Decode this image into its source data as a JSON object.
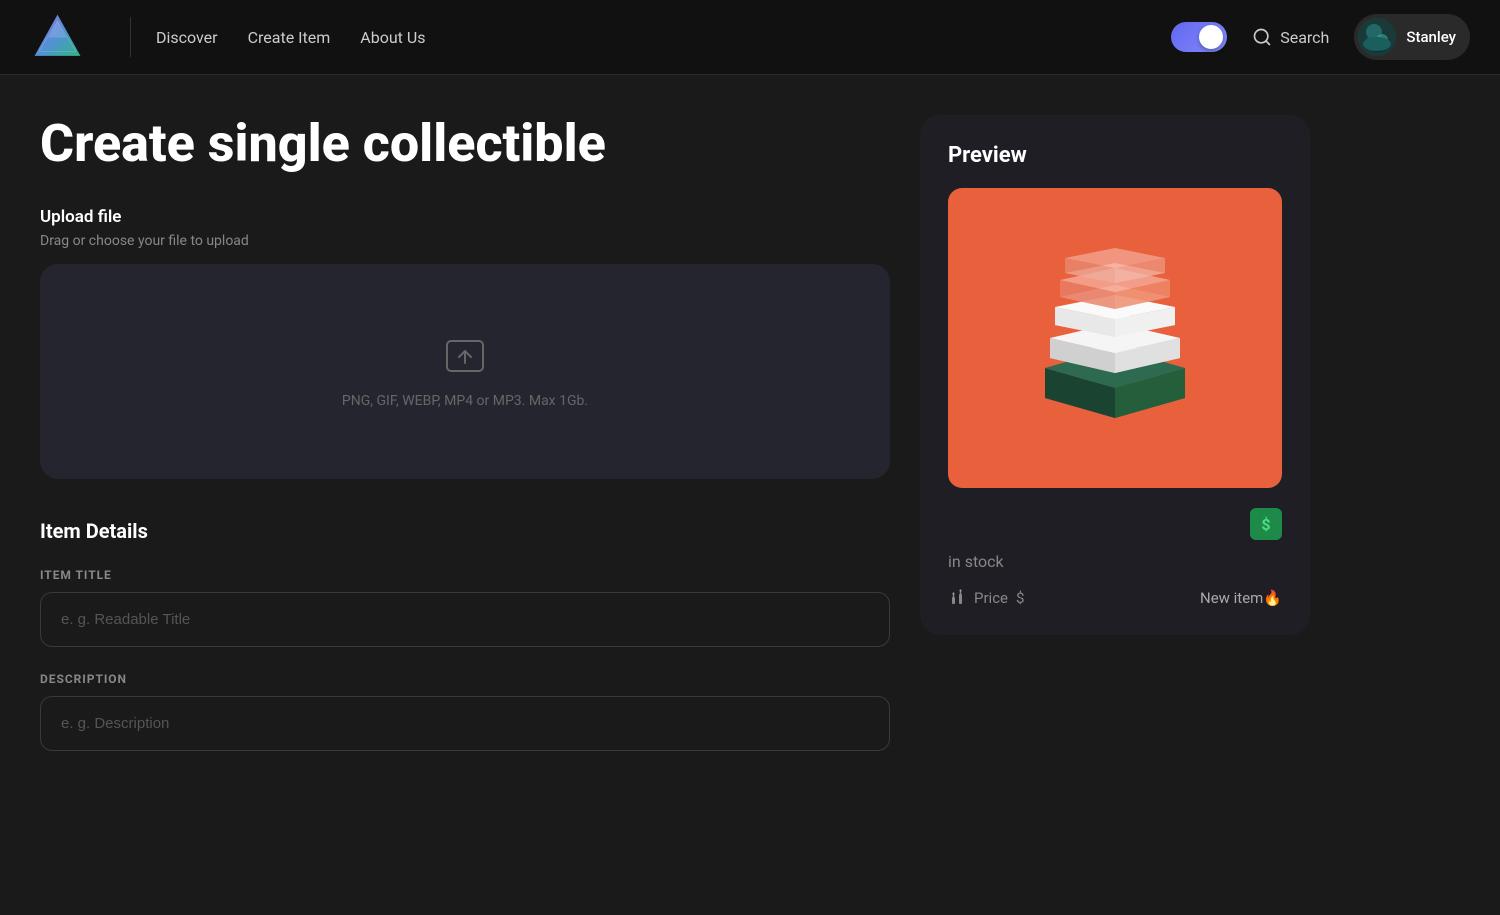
{
  "navbar": {
    "logo_alt": "Logo",
    "nav_links": [
      {
        "label": "Discover",
        "id": "discover"
      },
      {
        "label": "Create Item",
        "id": "create-item"
      },
      {
        "label": "About Us",
        "id": "about-us"
      }
    ],
    "search_label": "Search",
    "username": "Stanley",
    "toggle_on": true
  },
  "page": {
    "title": "Create single collectible",
    "upload": {
      "label": "Upload file",
      "sublabel": "Drag or choose your file to upload",
      "hint": "PNG, GIF, WEBP, MP4 or MP3. Max 1Gb."
    },
    "item_details": {
      "section_title": "Item Details",
      "fields": [
        {
          "id": "item-title",
          "label": "ITEM TITLE",
          "placeholder": "e. g. Readable Title"
        },
        {
          "id": "description",
          "label": "DESCRIPTION",
          "placeholder": "e. g. Description"
        }
      ]
    }
  },
  "preview": {
    "title": "Preview",
    "in_stock": "in stock",
    "price_label": "Price",
    "price_symbol": "$",
    "new_item_label": "New item",
    "new_item_emoji": "🔥",
    "price_badge_symbol": "$"
  }
}
